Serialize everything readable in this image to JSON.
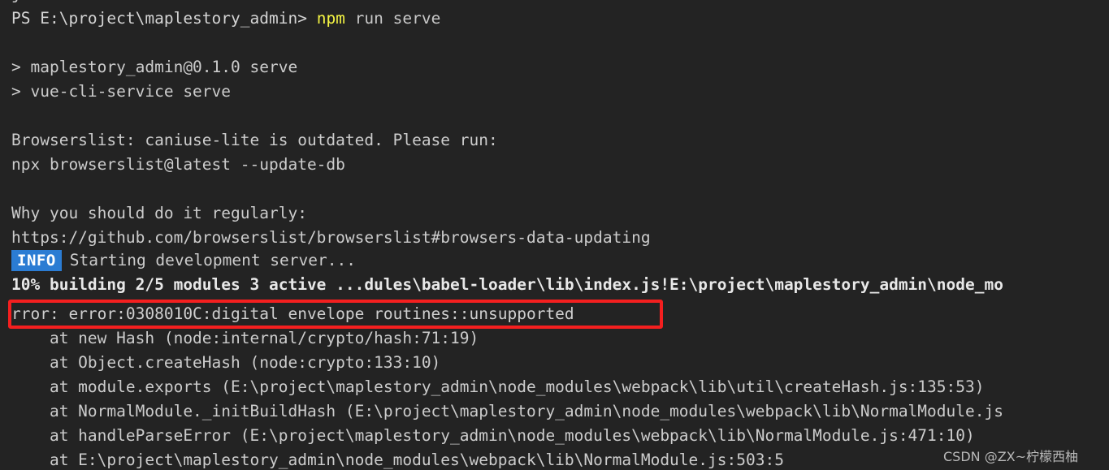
{
  "terminal": {
    "background_color": "#232323",
    "foreground_color": "#cccccc",
    "top_partial_fragment": "j",
    "prompt": {
      "text": "PS E:\\project\\maplestory_admin>",
      "command_keyword": "npm",
      "command_args": " run serve"
    },
    "lines": [
      {
        "id": "pkg_line",
        "text": "> maplestory_admin@0.1.0 serve"
      },
      {
        "id": "script_line",
        "text": "> vue-cli-service serve"
      },
      {
        "id": "blank_1",
        "text": ""
      },
      {
        "id": "bl_warn_1",
        "text": "Browserslist: caniuse-lite is outdated. Please run:"
      },
      {
        "id": "bl_warn_2",
        "text": "npx browserslist@latest --update-db"
      },
      {
        "id": "blank_2",
        "text": ""
      },
      {
        "id": "bl_why",
        "text": "Why you should do it regularly:"
      },
      {
        "id": "bl_url",
        "text": "https://github.com/browserslist/browserslist#browsers-data-updating"
      }
    ],
    "info_line": {
      "badge": "INFO",
      "badge_color": "#2b7cd3",
      "message": "Starting development server..."
    },
    "progress_line": {
      "text": "10% building 2/5 modules 3 active ...dules\\babel-loader\\lib\\index.js!E:\\project\\maplestory_admin\\node_mo"
    },
    "error_line": {
      "text": "rror: error:0308010C:digital envelope routines::unsupported",
      "highlight_color": "#f41f1f"
    },
    "stack_trace": [
      "    at new Hash (node:internal/crypto/hash:71:19)",
      "    at Object.createHash (node:crypto:133:10)",
      "    at module.exports (E:\\project\\maplestory_admin\\node_modules\\webpack\\lib\\util\\createHash.js:135:53)",
      "    at NormalModule._initBuildHash (E:\\project\\maplestory_admin\\node_modules\\webpack\\lib\\NormalModule.js",
      "    at handleParseError (E:\\project\\maplestory_admin\\node_modules\\webpack\\lib\\NormalModule.js:471:10)",
      "    at E:\\project\\maplestory_admin\\node_modules\\webpack\\lib\\NormalModule.js:503:5"
    ]
  },
  "watermark": {
    "text": "CSDN @ZX~柠檬西柚"
  }
}
